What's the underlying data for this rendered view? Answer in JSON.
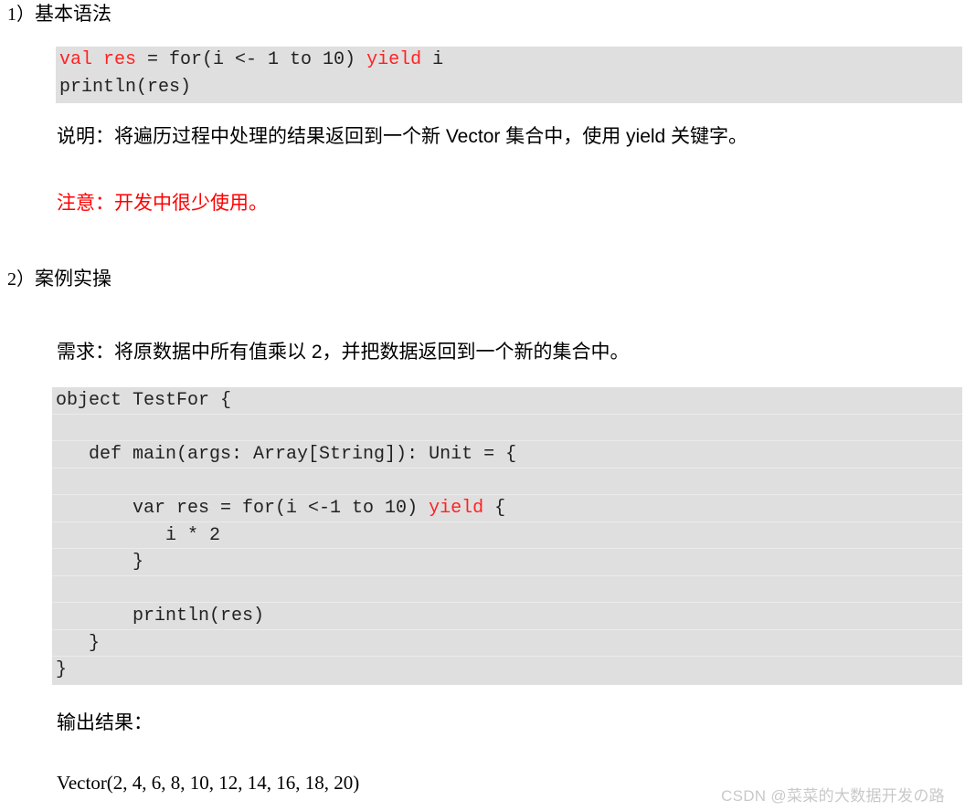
{
  "document": {
    "sections": [
      {
        "number": "1）",
        "title": "基本语法"
      },
      {
        "number": "2）",
        "title": "案例实操"
      }
    ],
    "notes": {
      "explanation": "说明：将遍历过程中处理的结果返回到一个新 Vector 集合中，使用 yield 关键字。",
      "warning": "注意：开发中很少使用。",
      "requirement": "需求：将原数据中所有值乘以 2，并把数据返回到一个新的集合中。",
      "output_label": "输出结果：",
      "output_value": "Vector(2, 4, 6, 8, 10, 12, 14, 16, 18, 20)"
    },
    "code_block_1": {
      "lines": [
        [
          {
            "text": "val res ",
            "color": "red"
          },
          {
            "text": "= for(i <- 1 to 10) ",
            "color": "plain"
          },
          {
            "text": "yield",
            "color": "red"
          },
          {
            "text": " i",
            "color": "plain"
          }
        ],
        [
          {
            "text": "println(res)",
            "color": "plain"
          }
        ]
      ]
    },
    "code_block_2": {
      "lines": [
        [
          {
            "text": "object TestFor {",
            "color": "plain"
          }
        ],
        [
          {
            "text": "",
            "color": "plain"
          }
        ],
        [
          {
            "text": "   def main(args: Array[String]): Unit = {",
            "color": "plain"
          }
        ],
        [
          {
            "text": "",
            "color": "plain"
          }
        ],
        [
          {
            "text": "       var res = for(i <-1 to 10) ",
            "color": "plain"
          },
          {
            "text": "yield",
            "color": "red"
          },
          {
            "text": " {",
            "color": "plain"
          }
        ],
        [
          {
            "text": "          i * 2",
            "color": "plain"
          }
        ],
        [
          {
            "text": "       }",
            "color": "plain"
          }
        ],
        [
          {
            "text": "",
            "color": "plain"
          }
        ],
        [
          {
            "text": "       println(res)",
            "color": "plain"
          }
        ],
        [
          {
            "text": "   }",
            "color": "plain"
          }
        ],
        [
          {
            "text": "}",
            "color": "plain"
          }
        ]
      ]
    },
    "watermark": "CSDN @菜菜的大数据开发の路",
    "colors": {
      "code_background": "#dfdfdf",
      "keyword_red": "#ff2222",
      "warning_red": "#ff0000",
      "watermark_gray": "#c9c9c9"
    }
  }
}
